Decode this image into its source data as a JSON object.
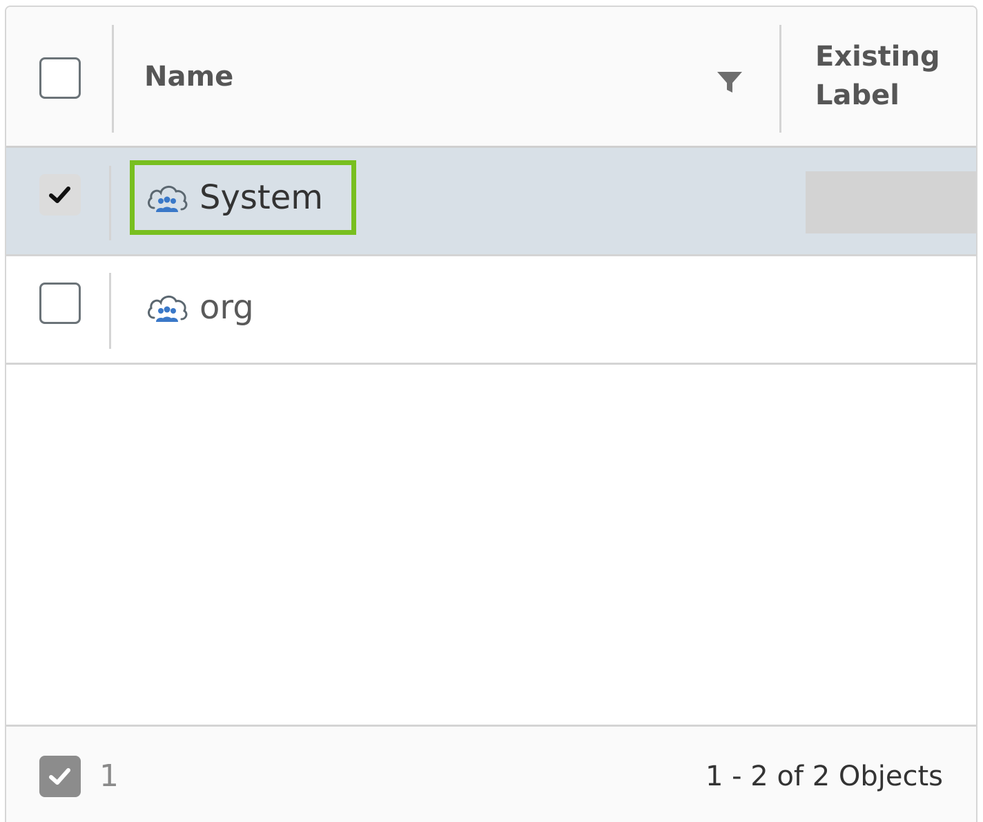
{
  "header": {
    "name_label": "Name",
    "existing_label_line1": "Existing",
    "existing_label_line2": "Label",
    "select_all_checked": false
  },
  "rows": [
    {
      "name": "System",
      "checked": true,
      "icon": "cloud-group-icon",
      "highlighted": true
    },
    {
      "name": "org",
      "checked": false,
      "icon": "cloud-group-icon",
      "highlighted": false
    }
  ],
  "footer": {
    "selected_count": "1",
    "range_text": "1 - 2 of 2 Objects"
  },
  "colors": {
    "selected_row": "#d8e0e7",
    "highlight_border": "#78bf1f",
    "icon_blue": "#3a78c8"
  }
}
